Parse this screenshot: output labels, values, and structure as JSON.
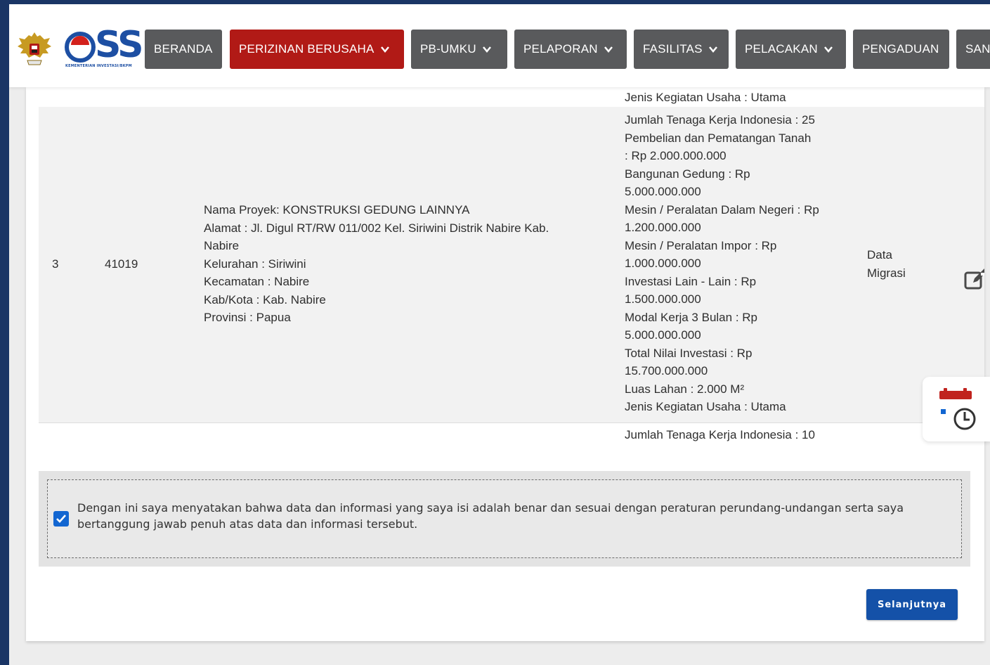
{
  "navbar": {
    "logo_text": "OSS",
    "logo_subtext": "KEMENTERIAN INVESTASI/BKPM",
    "items": [
      {
        "label": "BERANDA",
        "dropdown": false,
        "active": false
      },
      {
        "label": "PERIZINAN BERUSAHA",
        "dropdown": true,
        "active": true
      },
      {
        "label": "PB-UMKU",
        "dropdown": true,
        "active": false
      },
      {
        "label": "PELAPORAN",
        "dropdown": true,
        "active": false
      },
      {
        "label": "FASILITAS",
        "dropdown": true,
        "active": false
      },
      {
        "label": "PELACAKAN",
        "dropdown": true,
        "active": false
      },
      {
        "label": "PENGADUAN",
        "dropdown": false,
        "active": false
      },
      {
        "label": "SAN",
        "dropdown": false,
        "active": false
      }
    ]
  },
  "table": {
    "previous_row_tail": "Jenis Kegiatan Usaha : Utama",
    "row": {
      "no": "3",
      "kbli": "41019",
      "location_lines": [
        "Nama Proyek: KONSTRUKSI GEDUNG LAINNYA",
        "Alamat : Jl. Digul RT/RW 011/002 Kel. Siriwini Distrik Nabire Kab.",
        "Nabire",
        "Kelurahan : Siriwini",
        "Kecamatan : Nabire",
        "Kab/Kota : Kab. Nabire",
        "Provinsi : Papua"
      ],
      "investment_lines": [
        "Jumlah Tenaga Kerja Indonesia : 25",
        "Pembelian dan Pematangan Tanah",
        ": Rp 2.000.000.000",
        "Bangunan Gedung : Rp",
        "5.000.000.000",
        "Mesin / Peralatan Dalam Negeri : Rp",
        "1.200.000.000",
        "Mesin / Peralatan Impor : Rp",
        "1.000.000.000",
        "Investasi Lain - Lain : Rp",
        "1.500.000.000",
        "Modal Kerja 3 Bulan : Rp",
        "5.000.000.000",
        "Total Nilai Investasi : Rp",
        "15.700.000.000",
        "Luas Lahan : 2.000 M²",
        "Jenis Kegiatan Usaha : Utama"
      ],
      "status_lines": [
        "Data",
        "Migrasi"
      ],
      "action_icon": "edit-icon"
    },
    "next_row_head": "Jumlah Tenaga Kerja Indonesia : 10"
  },
  "declaration": {
    "checked": true,
    "text": "Dengan ini saya menyatakan bahwa data dan informasi yang saya isi adalah benar dan sesuai dengan peraturan perundang-undangan serta saya bertanggung jawab penuh atas data dan informasi tersebut."
  },
  "next_button": {
    "label": "Selanjutnya"
  },
  "float_widget": {
    "icon": "calendar-clock-icon"
  },
  "colors": {
    "frame": "#1a3565",
    "nav_button": "#595a5c",
    "nav_active": "#b11a16",
    "brand_blue": "#1d4fa3",
    "primary_button": "#1451a8",
    "checkbox": "#1266d1"
  }
}
